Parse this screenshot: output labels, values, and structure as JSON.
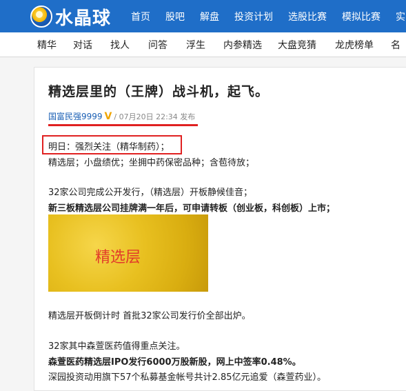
{
  "header": {
    "logo_text": "水晶球",
    "nav": [
      "首页",
      "股吧",
      "解盘",
      "投资计划",
      "选股比赛",
      "模拟比赛",
      "实"
    ]
  },
  "subnav": [
    "精华",
    "对话",
    "找人",
    "问答",
    "浮生",
    "内参精选",
    "大盘竞猜",
    "龙虎榜单",
    "名"
  ],
  "article": {
    "title": "精选层里的（王牌）战斗机，起飞。",
    "author": "国富民强9999",
    "badge": "V",
    "date": "/ 07月20日 22:34 发布",
    "lines": [
      "明日：强烈关注（精华制药）；",
      "精选层；小盘绩优；坐拥中药保密品种；含苞待放；",
      "32家公司完成公开发行，（精选层）开板静候佳音；",
      "新三板精选层公司挂牌满一年后，可申请转板（创业板，科创板）上市；",
      "精选层开板倒计时 首批32家公司发行价全部出炉。",
      "32家其中森萱医药值得重点关注。",
      "森萱医药精选层IPO发行6000万股新股，网上中签率0.48%。",
      "深园投资动用旗下57个私募基金帐号共计2.85亿元追爱（森萱药业）。"
    ],
    "image_text": "精选层"
  },
  "colors": {
    "topbar": "#1f6ec8",
    "highlight": "#e02020",
    "author": "#1a5fb4"
  }
}
